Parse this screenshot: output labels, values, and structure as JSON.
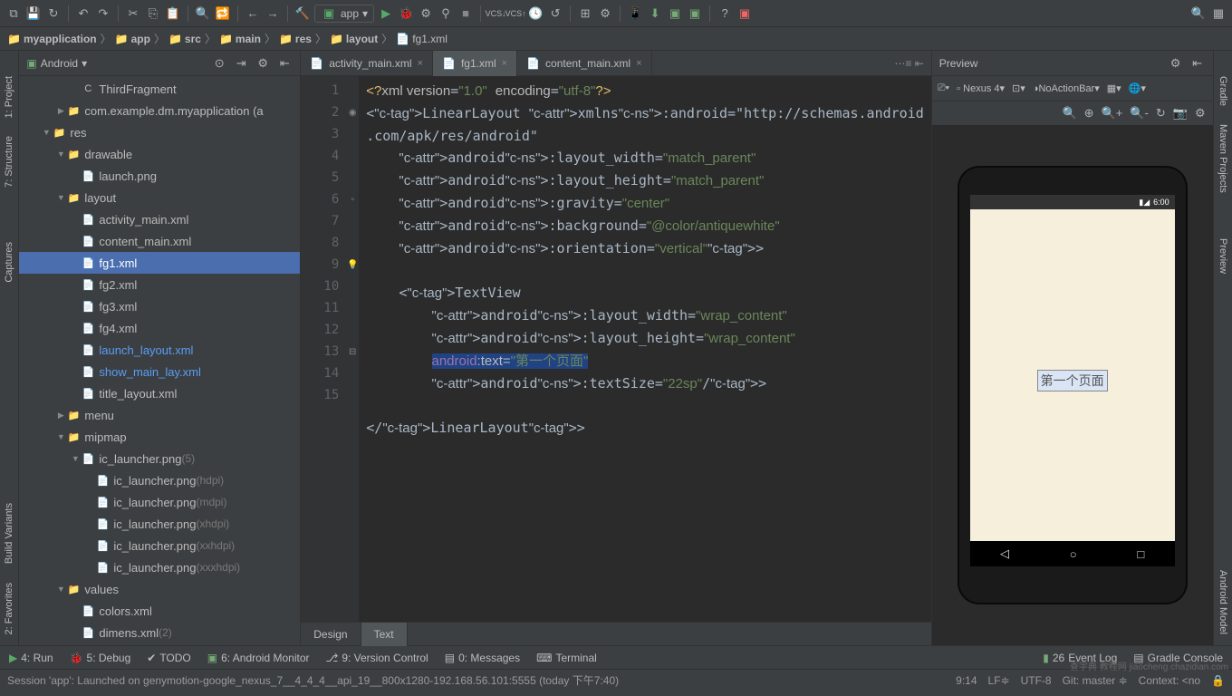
{
  "toolbar": {
    "module": "app"
  },
  "breadcrumb": [
    "myapplication",
    "app",
    "src",
    "main",
    "res",
    "layout",
    "fg1.xml"
  ],
  "project": {
    "view": "Android",
    "tree": [
      {
        "d": 3,
        "a": "",
        "i": "C",
        "l": "ThirdFragment",
        "cls": ""
      },
      {
        "d": 2,
        "a": "▶",
        "i": "📁",
        "l": "com.example.dm.myapplication (a",
        "cls": ""
      },
      {
        "d": 1,
        "a": "▼",
        "i": "📁",
        "l": "res",
        "cls": ""
      },
      {
        "d": 2,
        "a": "▼",
        "i": "📁",
        "l": "drawable",
        "cls": ""
      },
      {
        "d": 3,
        "a": "",
        "i": "📄",
        "l": "launch.png",
        "cls": ""
      },
      {
        "d": 2,
        "a": "▼",
        "i": "📁",
        "l": "layout",
        "cls": ""
      },
      {
        "d": 3,
        "a": "",
        "i": "📄",
        "l": "activity_main.xml",
        "cls": ""
      },
      {
        "d": 3,
        "a": "",
        "i": "📄",
        "l": "content_main.xml",
        "cls": ""
      },
      {
        "d": 3,
        "a": "",
        "i": "📄",
        "l": "fg1.xml",
        "cls": "selected"
      },
      {
        "d": 3,
        "a": "",
        "i": "📄",
        "l": "fg2.xml",
        "cls": ""
      },
      {
        "d": 3,
        "a": "",
        "i": "📄",
        "l": "fg3.xml",
        "cls": ""
      },
      {
        "d": 3,
        "a": "",
        "i": "📄",
        "l": "fg4.xml",
        "cls": ""
      },
      {
        "d": 3,
        "a": "",
        "i": "📄",
        "l": "launch_layout.xml",
        "cls": "blue"
      },
      {
        "d": 3,
        "a": "",
        "i": "📄",
        "l": "show_main_lay.xml",
        "cls": "blue"
      },
      {
        "d": 3,
        "a": "",
        "i": "📄",
        "l": "title_layout.xml",
        "cls": ""
      },
      {
        "d": 2,
        "a": "▶",
        "i": "📁",
        "l": "menu",
        "cls": ""
      },
      {
        "d": 2,
        "a": "▼",
        "i": "📁",
        "l": "mipmap",
        "cls": ""
      },
      {
        "d": 3,
        "a": "▼",
        "i": "📄",
        "l": "ic_launcher.png",
        "suffix": "(5)",
        "cls": ""
      },
      {
        "d": 4,
        "a": "",
        "i": "📄",
        "l": "ic_launcher.png",
        "suffix": "(hdpi)",
        "cls": ""
      },
      {
        "d": 4,
        "a": "",
        "i": "📄",
        "l": "ic_launcher.png",
        "suffix": "(mdpi)",
        "cls": ""
      },
      {
        "d": 4,
        "a": "",
        "i": "📄",
        "l": "ic_launcher.png",
        "suffix": "(xhdpi)",
        "cls": ""
      },
      {
        "d": 4,
        "a": "",
        "i": "📄",
        "l": "ic_launcher.png",
        "suffix": "(xxhdpi)",
        "cls": ""
      },
      {
        "d": 4,
        "a": "",
        "i": "📄",
        "l": "ic_launcher.png",
        "suffix": "(xxxhdpi)",
        "cls": ""
      },
      {
        "d": 2,
        "a": "▼",
        "i": "📁",
        "l": "values",
        "cls": ""
      },
      {
        "d": 3,
        "a": "",
        "i": "📄",
        "l": "colors.xml",
        "cls": ""
      },
      {
        "d": 3,
        "a": "",
        "i": "📄",
        "l": "dimens.xml",
        "suffix": "(2)",
        "cls": ""
      }
    ]
  },
  "tabs": [
    {
      "l": "activity_main.xml",
      "active": false
    },
    {
      "l": "fg1.xml",
      "active": true
    },
    {
      "l": "content_main.xml",
      "active": false
    }
  ],
  "code": {
    "lines": 15,
    "raw": [
      "<?xml version=\"1.0\" encoding=\"utf-8\"?>",
      "<LinearLayout xmlns:android=\"http://schemas.android",
      ".com/apk/res/android\"",
      "    android:layout_width=\"match_parent\"",
      "    android:layout_height=\"match_parent\"",
      "    android:gravity=\"center\"",
      "    android:background=\"@color/antiquewhite\"",
      "    android:orientation=\"vertical\">",
      "",
      "    <TextView",
      "        android:layout_width=\"wrap_content\"",
      "        android:layout_height=\"wrap_content\"",
      "        android:text=\"第一个页面\"",
      "        android:textSize=\"22sp\"/>",
      "",
      "</LinearLayout>"
    ]
  },
  "editorFooter": {
    "design": "Design",
    "text": "Text"
  },
  "preview": {
    "title": "Preview",
    "device": "Nexus 4",
    "theme": "NoActionBar",
    "time": "6:00",
    "text": "第一个页面"
  },
  "leftGutter": [
    "1: Project",
    "7: Structure",
    "Captures"
  ],
  "leftGutter2": [
    "Build Variants",
    "2: Favorites"
  ],
  "rightGutter": [
    "Gradle",
    "Maven Projects",
    "Preview",
    "Android Model"
  ],
  "bottom": {
    "run": "4: Run",
    "debug": "5: Debug",
    "todo": "TODO",
    "android": "6: Android Monitor",
    "vcs": "9: Version Control",
    "msg": "0: Messages",
    "term": "Terminal",
    "event": "Event Log",
    "gradle": "Gradle Console"
  },
  "status": {
    "msg": "Session 'app': Launched on genymotion-google_nexus_7__4_4_4__api_19__800x1280-192.168.56.101:5555 (today 下午7:40)",
    "pos": "9:14",
    "lf": "LF≑",
    "enc": "UTF-8",
    "git": "Git: master ≑",
    "ctx": "Context: <no",
    "eventcount": "26"
  },
  "watermark": "查字典 教程网 jiaocheng.chazidian.com"
}
